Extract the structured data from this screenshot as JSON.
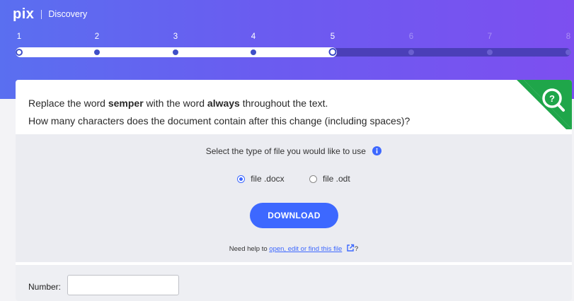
{
  "brand": {
    "logo": "pix",
    "title": "Discovery"
  },
  "progress": {
    "steps": [
      "1",
      "2",
      "3",
      "4",
      "5",
      "6",
      "7",
      "8"
    ],
    "current_step": 5,
    "total_steps": 8
  },
  "question": {
    "line1_prefix": "Replace the word ",
    "word_from": "semper",
    "line1_middle": " with the word ",
    "word_to": "always",
    "line1_suffix": " throughout the text.",
    "line2": "How many characters does the document contain after this change (including spaces)?"
  },
  "file_section": {
    "prompt": "Select the type of file you would like to use",
    "options": [
      {
        "label": "file .docx",
        "selected": true
      },
      {
        "label": "file .odt",
        "selected": false
      }
    ],
    "download_label": "DOWNLOAD",
    "help_prefix": "Need help to ",
    "help_link": "open, edit or find this file",
    "help_suffix": "?"
  },
  "answer": {
    "label": "Number:",
    "value": ""
  },
  "icons": {
    "challenge": "magnifier-question-icon",
    "info": "info-icon",
    "external": "external-link-icon"
  },
  "colors": {
    "header_start": "#5a6ff0",
    "header_end": "#7d4ff0",
    "accent": "#3d68ff",
    "challenge_green": "#1fa64a"
  }
}
